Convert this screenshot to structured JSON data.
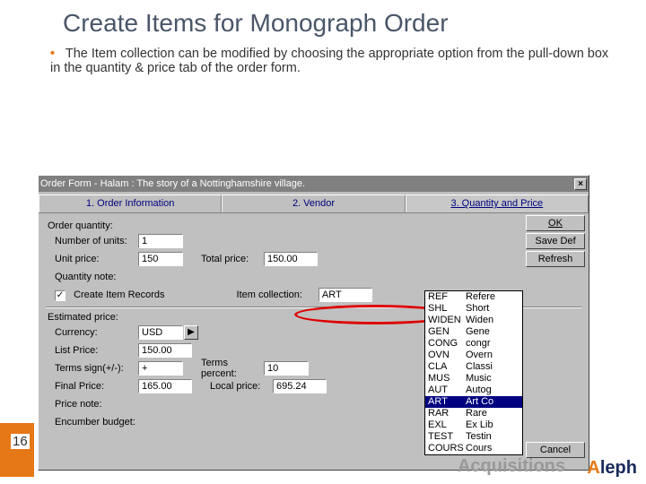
{
  "slide": {
    "title": "Create Items for Monograph Order",
    "bullet": "The Item collection can be modified by choosing the appropriate option from the pull-down box in the quantity & price tab of the order form.",
    "page_number": "16",
    "footer": "Acquisitions",
    "logo": "leph",
    "logo_a": "A"
  },
  "win": {
    "title": "Order Form - Halam : The story of a Nottinghamshire village.",
    "tabs": [
      "1. Order Information",
      "2. Vendor",
      "3. Quantity and Price"
    ],
    "active_tab": 2,
    "buttons": {
      "ok": "OK",
      "savedef": "Save Def",
      "refresh": "Refresh",
      "cancel": "Cancel"
    },
    "order_quantity": {
      "section": "Order quantity:",
      "units_label": "Number of units:",
      "units": "1",
      "unitprice_label": "Unit price:",
      "unitprice": "150",
      "totalprice_label": "Total price:",
      "totalprice": "150.00",
      "qtynote_label": "Quantity note:",
      "createitems_label": "Create Item Records",
      "createitems_checked": "✓",
      "itemcollection_label": "Item collection:",
      "itemcollection": "ART"
    },
    "estimated": {
      "section": "Estimated price:",
      "currency_label": "Currency:",
      "currency": "USD",
      "listprice_label": "List Price:",
      "listprice": "150.00",
      "termssign_label": "Terms sign(+/-):",
      "termssign": "+",
      "termspercent_label": "Terms percent:",
      "termspercent": "10",
      "finalprice_label": "Final Price:",
      "finalprice": "165.00",
      "localprice_label": "Local price:",
      "localprice": "695.24",
      "pricenote_label": "Price note:",
      "encumber_label": "Encumber budget:"
    }
  },
  "dropdown": {
    "items": [
      {
        "code": "REF",
        "desc": "Refere"
      },
      {
        "code": "SHL",
        "desc": "Short"
      },
      {
        "code": "WIDEN",
        "desc": "Widen"
      },
      {
        "code": "GEN",
        "desc": "Gene"
      },
      {
        "code": "CONG",
        "desc": "congr"
      },
      {
        "code": "OVN",
        "desc": "Overn"
      },
      {
        "code": "CLA",
        "desc": "Classi"
      },
      {
        "code": "MUS",
        "desc": "Music"
      },
      {
        "code": "AUT",
        "desc": "Autog"
      },
      {
        "code": "ART",
        "desc": "Art Co"
      },
      {
        "code": "RAR",
        "desc": "Rare"
      },
      {
        "code": "EXL",
        "desc": "Ex Lib"
      },
      {
        "code": "TEST",
        "desc": "Testin"
      },
      {
        "code": "COURS",
        "desc": "Cours"
      }
    ],
    "selected_index": 9
  }
}
